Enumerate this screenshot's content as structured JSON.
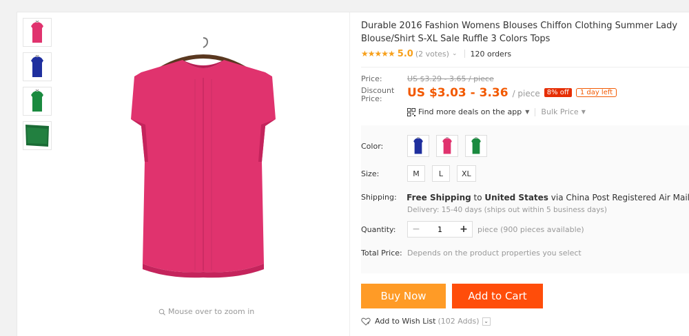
{
  "product": {
    "title": "Durable 2016 Fashion Womens Blouses Chiffon Clothing Summer Lady Blouse/Shirt S-XL Sale Ruffle 3 Colors Tops",
    "stars": "★★★★★",
    "rating": "5.0",
    "votes": "(2 votes)",
    "orders": "120 orders"
  },
  "gallery": {
    "thumbnails": [
      "pink-blouse",
      "blue-blouse",
      "green-blouse",
      "green-fabric"
    ],
    "zoom_hint": "Mouse over to zoom in",
    "main_color": "#e0336e"
  },
  "price": {
    "price_label": "Price:",
    "original": "US $3.29 - 3.65 / piece",
    "discount_label": "Discount Price:",
    "discounted": "US $3.03 - 3.36",
    "per_piece": "/ piece",
    "off_badge": "8% off",
    "days_left": "1 day left",
    "app_deals": "Find more deals on the app",
    "bulk_price": "Bulk Price"
  },
  "sku": {
    "color_label": "Color:",
    "colors": [
      "#1f2f9e",
      "#e0336e",
      "#1a8a3f"
    ],
    "size_label": "Size:",
    "sizes": [
      "M",
      "L",
      "XL"
    ],
    "shipping_label": "Shipping:",
    "shipping_free": "Free Shipping",
    "shipping_to": " to ",
    "shipping_country": "United States",
    "shipping_via": " via China Post Registered Air Mail",
    "delivery": "Delivery: 15-40 days (ships out within 5 business days)",
    "quantity_label": "Quantity:",
    "quantity_value": "1",
    "available": "piece (900 pieces available)",
    "total_label": "Total Price:",
    "total_hint": "Depends on the product properties you select"
  },
  "actions": {
    "buy_now": "Buy Now",
    "add_to_cart": "Add to Cart",
    "wish_list": "Add to Wish List",
    "wish_count": "(102 Adds)"
  },
  "colors": {
    "accent_orange": "#f25900",
    "buy_now_bg": "#ff9b26",
    "cart_bg": "#ff4d0a",
    "star": "#f7a01b"
  }
}
